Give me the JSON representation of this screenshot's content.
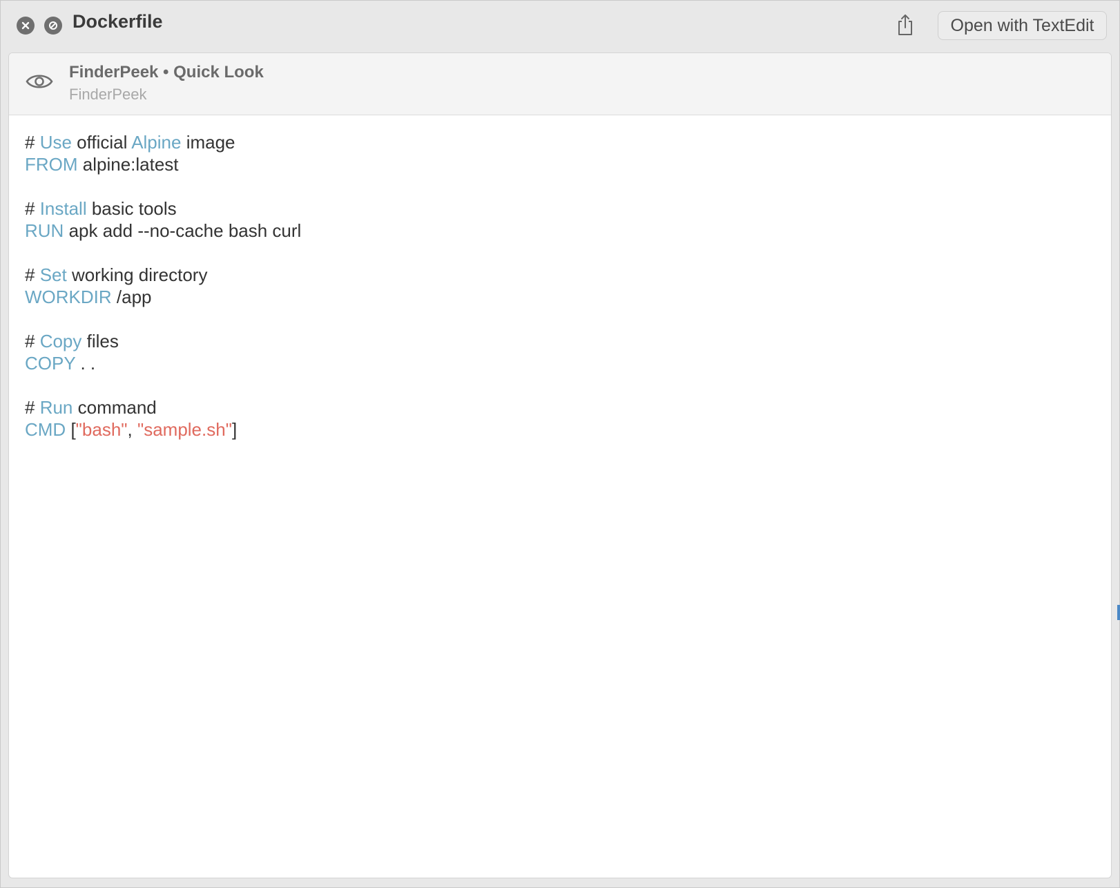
{
  "window": {
    "title": "Dockerfile",
    "open_with_label": "Open with TextEdit"
  },
  "icons": {
    "close": "close-circle-icon",
    "stop": "stop-circle-icon",
    "share": "share-icon",
    "eye": "eye-icon"
  },
  "quicklook": {
    "title": "FinderPeek • Quick Look",
    "subtitle": "FinderPeek"
  },
  "code": {
    "lines": [
      {
        "segments": [
          {
            "t": "# ",
            "c": "plain"
          },
          {
            "t": "Use",
            "c": "kw"
          },
          {
            "t": " official ",
            "c": "plain"
          },
          {
            "t": "Alpine",
            "c": "kw"
          },
          {
            "t": " image",
            "c": "plain"
          }
        ]
      },
      {
        "segments": [
          {
            "t": "FROM",
            "c": "kw"
          },
          {
            "t": " alpine:latest",
            "c": "plain"
          }
        ]
      },
      {
        "segments": [
          {
            "t": "",
            "c": "plain"
          }
        ]
      },
      {
        "segments": [
          {
            "t": "# ",
            "c": "plain"
          },
          {
            "t": "Install",
            "c": "kw"
          },
          {
            "t": " basic tools",
            "c": "plain"
          }
        ]
      },
      {
        "segments": [
          {
            "t": "RUN",
            "c": "kw"
          },
          {
            "t": " apk add --no-cache bash curl",
            "c": "plain"
          }
        ]
      },
      {
        "segments": [
          {
            "t": "",
            "c": "plain"
          }
        ]
      },
      {
        "segments": [
          {
            "t": "# ",
            "c": "plain"
          },
          {
            "t": "Set",
            "c": "kw"
          },
          {
            "t": " working directory",
            "c": "plain"
          }
        ]
      },
      {
        "segments": [
          {
            "t": "WORKDIR",
            "c": "kw"
          },
          {
            "t": " /app",
            "c": "plain"
          }
        ]
      },
      {
        "segments": [
          {
            "t": "",
            "c": "plain"
          }
        ]
      },
      {
        "segments": [
          {
            "t": "# ",
            "c": "plain"
          },
          {
            "t": "Copy",
            "c": "kw"
          },
          {
            "t": " files",
            "c": "plain"
          }
        ]
      },
      {
        "segments": [
          {
            "t": "COPY",
            "c": "kw"
          },
          {
            "t": " . .",
            "c": "plain"
          }
        ]
      },
      {
        "segments": [
          {
            "t": "",
            "c": "plain"
          }
        ]
      },
      {
        "segments": [
          {
            "t": "# ",
            "c": "plain"
          },
          {
            "t": "Run",
            "c": "kw"
          },
          {
            "t": " command",
            "c": "plain"
          }
        ]
      },
      {
        "segments": [
          {
            "t": "CMD",
            "c": "kw"
          },
          {
            "t": " [",
            "c": "plain"
          },
          {
            "t": "\"bash\"",
            "c": "str"
          },
          {
            "t": ", ",
            "c": "plain"
          },
          {
            "t": "\"sample.sh\"",
            "c": "str"
          },
          {
            "t": "]",
            "c": "plain"
          }
        ]
      }
    ]
  },
  "colors": {
    "keyword": "#6aa7c4",
    "string": "#e06a5e",
    "text": "#333333"
  }
}
